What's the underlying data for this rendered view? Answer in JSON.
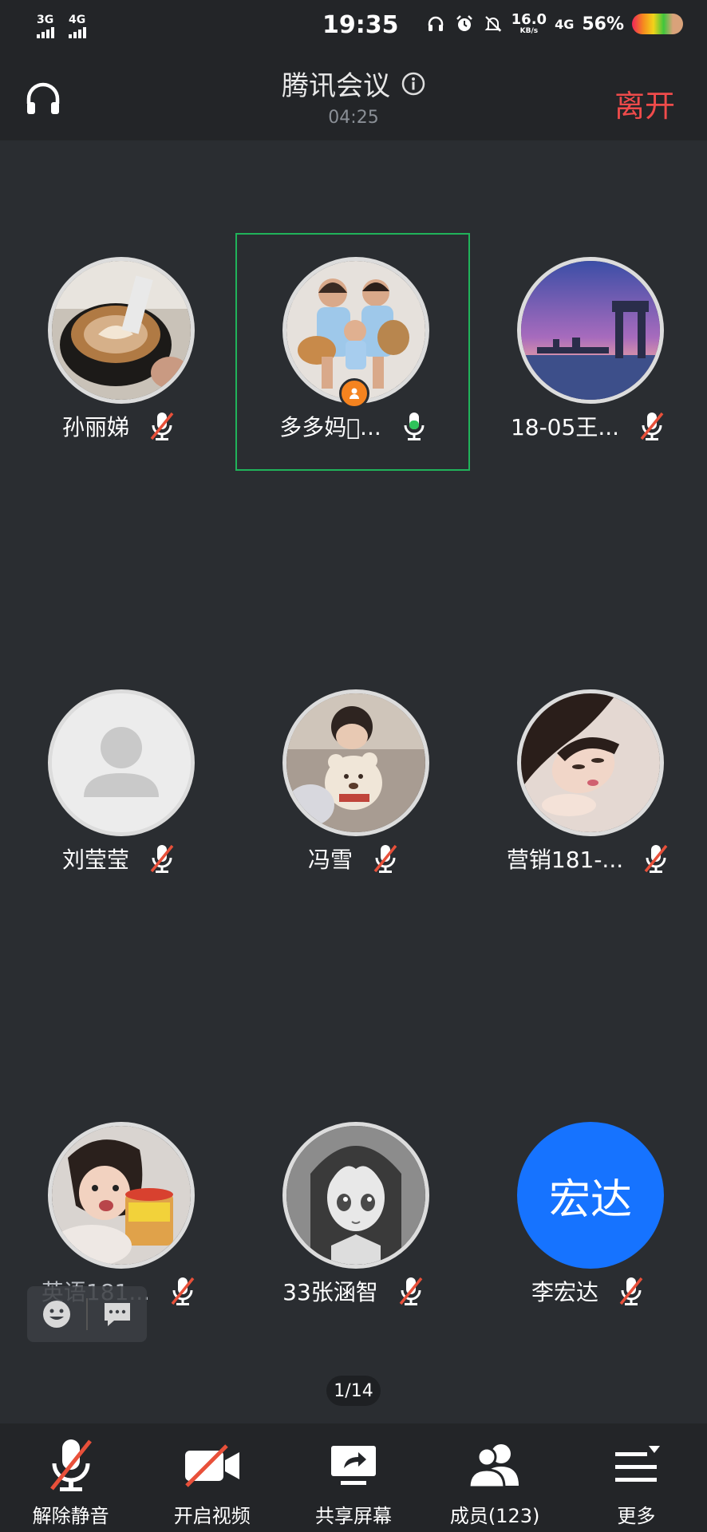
{
  "status_bar": {
    "signal1": "3G",
    "signal2": "4G",
    "time": "19:35",
    "speed_value": "16.0",
    "speed_unit": "KB/s",
    "network": "4G",
    "battery_percent": "56%"
  },
  "header": {
    "title": "腾讯会议",
    "timer": "04:25",
    "leave_label": "离开"
  },
  "participants": [
    {
      "name": "孙丽娣",
      "mic": "muted",
      "avatar": "latte-art-photo"
    },
    {
      "name": "多多妈\u0000...",
      "mic": "speaking",
      "avatar": "family-photo",
      "host": true
    },
    {
      "name": "18-05王...",
      "mic": "muted",
      "avatar": "sunset-gate-photo"
    },
    {
      "name": "刘莹莹",
      "mic": "muted",
      "avatar": "default-person"
    },
    {
      "name": "冯雪",
      "mic": "muted",
      "avatar": "girl-with-bear-photo"
    },
    {
      "name": "营销181-...",
      "mic": "muted",
      "avatar": "sleeping-girl-photo"
    },
    {
      "name": "英语181...",
      "mic": "muted",
      "avatar": "child-photo"
    },
    {
      "name": "33张涵智",
      "mic": "muted",
      "avatar": "anime-girl"
    },
    {
      "name": "李宏达",
      "mic": "muted",
      "avatar_text": "宏达"
    }
  ],
  "pager": "1/14",
  "toolbar": [
    {
      "label": "解除静音",
      "icon": "mic-muted-icon"
    },
    {
      "label": "开启视频",
      "icon": "video-off-icon"
    },
    {
      "label": "共享屏幕",
      "icon": "share-screen-icon"
    },
    {
      "label": "成员(123)",
      "icon": "members-icon"
    },
    {
      "label": "更多",
      "icon": "more-menu-icon"
    }
  ],
  "colors": {
    "background": "#2a2d31",
    "bar": "#232528",
    "leave": "#f04b4b",
    "speaking_border": "#20b35a",
    "mic_active": "#2fc35a",
    "mute_slash": "#e8503a",
    "avatar_blue": "#1673ff"
  }
}
